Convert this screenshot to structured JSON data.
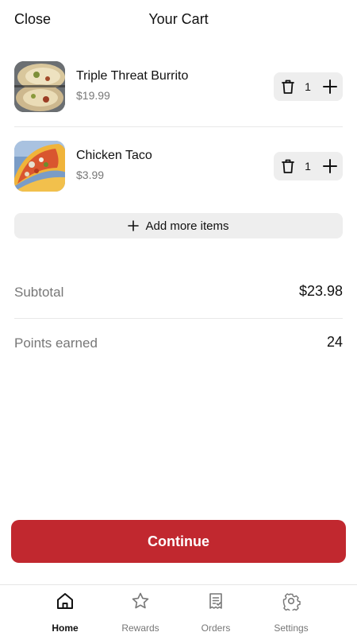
{
  "header": {
    "close_label": "Close",
    "title": "Your Cart"
  },
  "cart": {
    "items": [
      {
        "name": "Triple Threat Burrito",
        "price": "$19.99",
        "quantity": "1",
        "image_icon": "burrito-photo"
      },
      {
        "name": "Chicken Taco",
        "price": "$3.99",
        "quantity": "1",
        "image_icon": "taco-photo"
      }
    ],
    "add_more_label": "Add more items"
  },
  "summary": {
    "subtotal_label": "Subtotal",
    "subtotal_value": "$23.98",
    "points_label": "Points earned",
    "points_value": "24"
  },
  "continue_label": "Continue",
  "tabbar": {
    "tabs": [
      {
        "label": "Home",
        "icon": "home-icon",
        "active": true
      },
      {
        "label": "Rewards",
        "icon": "star-icon",
        "active": false
      },
      {
        "label": "Orders",
        "icon": "receipt-icon",
        "active": false
      },
      {
        "label": "Settings",
        "icon": "gear-icon",
        "active": false
      }
    ]
  },
  "colors": {
    "accent": "#c1282f",
    "muted_text": "#777777",
    "chip_bg": "#eeeeee"
  }
}
